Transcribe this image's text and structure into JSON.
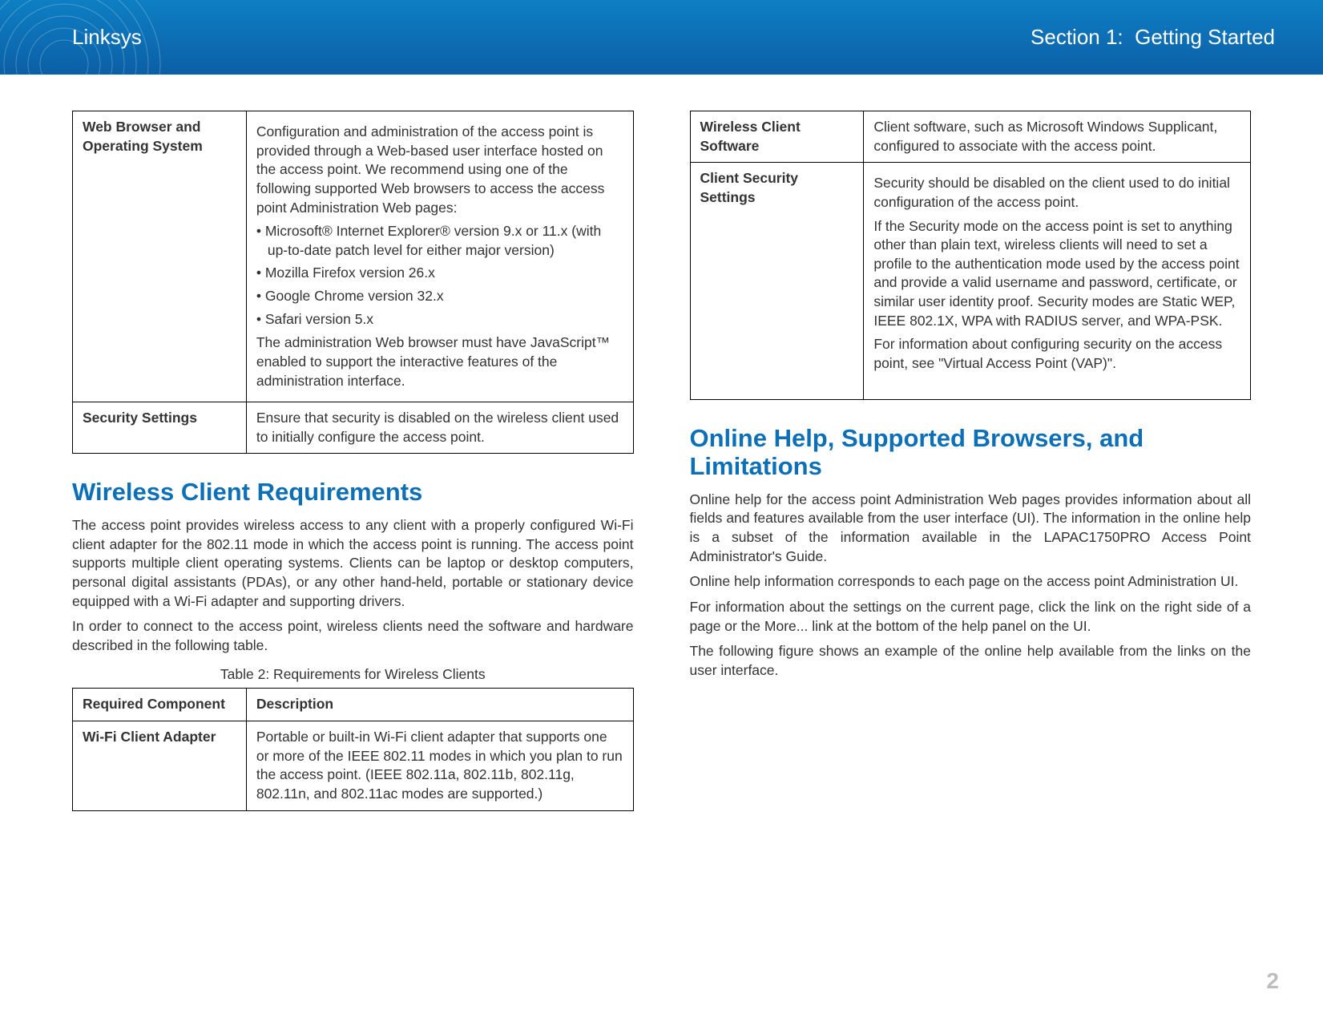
{
  "header": {
    "brand": "Linksys",
    "section_prefix": "Section 1:",
    "section_title": "Getting Started"
  },
  "left": {
    "t1": {
      "r1": {
        "label": "Web Browser and Operating System",
        "p1": "Configuration and administration of the access point is provided through a Web-based user interface hosted on the access point. We recommend using one of the following supported Web browsers to access the access point Administration Web pages:",
        "b1": "Microsoft® Internet Explorer® version 9.x or 11.x (with up-to-date patch level for either major version)",
        "b2": "Mozilla Firefox version 26.x",
        "b3": "Google Chrome version 32.x",
        "b4": "Safari version 5.x",
        "p2": "The administration Web browser must have JavaScript™ enabled to support the interactive features of the administration interface."
      },
      "r2": {
        "label": "Security Settings",
        "p1": "Ensure that security is disabled on the wireless client used to initially configure the access point."
      }
    },
    "h2": "Wireless Client Requirements",
    "p1": "The access point provides wireless access to any client with a properly configured Wi-Fi client adapter for the 802.11 mode in which the access point is running. The access point supports multiple client operating systems. Clients can be laptop or desktop computers, personal digital assistants (PDAs), or any other hand-held, portable or stationary device equipped with a Wi-Fi adapter and supporting drivers.",
    "p2": "In order to connect to the access point, wireless clients need the software and hardware described in the following table.",
    "caption": "Table 2: Requirements for Wireless Clients",
    "t2": {
      "h1": "Required Component",
      "h2": "Description",
      "r1": {
        "label": "Wi-Fi Client Adapter",
        "p1": "Portable or built-in Wi-Fi client adapter that supports one or more of the IEEE 802.11 modes in which you plan to run the access point. (IEEE 802.11a, 802.11b, 802.11g, 802.11n, and 802.11ac modes are supported.)"
      }
    }
  },
  "right": {
    "t1": {
      "r1": {
        "label": "Wireless Client Software",
        "p1": "Client software, such as Microsoft Windows Supplicant, configured to associate with the access point."
      },
      "r2": {
        "label": "Client Security Settings",
        "p1": "Security should be disabled on the client used to do initial configuration of the access point.",
        "p2": "If the Security mode on the access point is set to anything other than plain text, wireless clients will need to set a profile to the authentication mode used by the access point and provide a valid username and password, certificate, or similar user identity proof. Security modes are Static WEP, IEEE 802.1X, WPA with RADIUS server, and WPA-PSK.",
        "p3": "For information about configuring security on the access point, see \"Virtual Access Point (VAP)\"."
      }
    },
    "h2": "Online Help, Supported Browsers, and Limitations",
    "p1": "Online help for the access point Administration Web pages provides information about all fields and features available from the user interface (UI). The information in the online help is a subset of the information available in the LAPAC1750PRO Access Point Administrator's Guide.",
    "p2": "Online help information corresponds to each page on the access point Administration UI.",
    "p3": "For information about the settings on the current page, click the   link on the right side of a page or the More... link at the bottom of the help panel on the UI.",
    "p4": "The following figure shows an example of the online help available from the links on the user interface."
  },
  "pagenum": "2"
}
